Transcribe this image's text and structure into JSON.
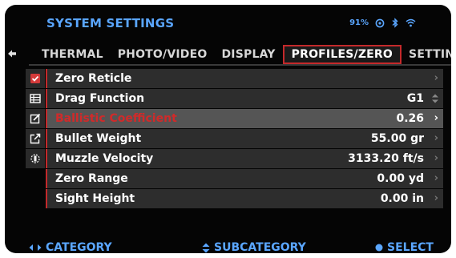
{
  "title": "SYSTEM SETTINGS",
  "status": {
    "battery": "91%"
  },
  "tabs": [
    {
      "label": "THERMAL",
      "active": false
    },
    {
      "label": "PHOTO/VIDEO",
      "active": false
    },
    {
      "label": "DISPLAY",
      "active": false
    },
    {
      "label": "PROFILES/ZERO",
      "active": true
    },
    {
      "label": "SETTINGS",
      "active": false
    }
  ],
  "rows": [
    {
      "icon": "checkbox-checked-icon",
      "label": "Zero Reticle",
      "value": "",
      "control": "chevron-right-icon",
      "selected": false
    },
    {
      "icon": "table-icon",
      "label": "Drag Function",
      "value": "G1",
      "control": "up-down-arrows-icon",
      "selected": false
    },
    {
      "icon": "edit-box-icon",
      "label": "Ballistic Coefficient",
      "value": "0.26",
      "control": "chevron-right-icon",
      "selected": true
    },
    {
      "icon": "export-icon",
      "label": "Bullet Weight",
      "value": "55.00 gr",
      "control": "chevron-right-icon",
      "selected": false
    },
    {
      "icon": "velocity-icon",
      "label": "Muzzle Velocity",
      "value": "3133.20 ft/s",
      "control": "chevron-right-icon",
      "selected": false
    },
    {
      "icon": "",
      "label": "Zero Range",
      "value": "0.00 yd",
      "control": "chevron-right-icon",
      "selected": false
    },
    {
      "icon": "",
      "label": "Sight Height",
      "value": "0.00 in",
      "control": "chevron-right-icon",
      "selected": false
    }
  ],
  "footer": {
    "category": "CATEGORY",
    "subcategory": "SUBCATEGORY",
    "select": "SELECT"
  },
  "colors": {
    "accent_blue": "#5aa6ff",
    "accent_red": "#c4292b"
  }
}
